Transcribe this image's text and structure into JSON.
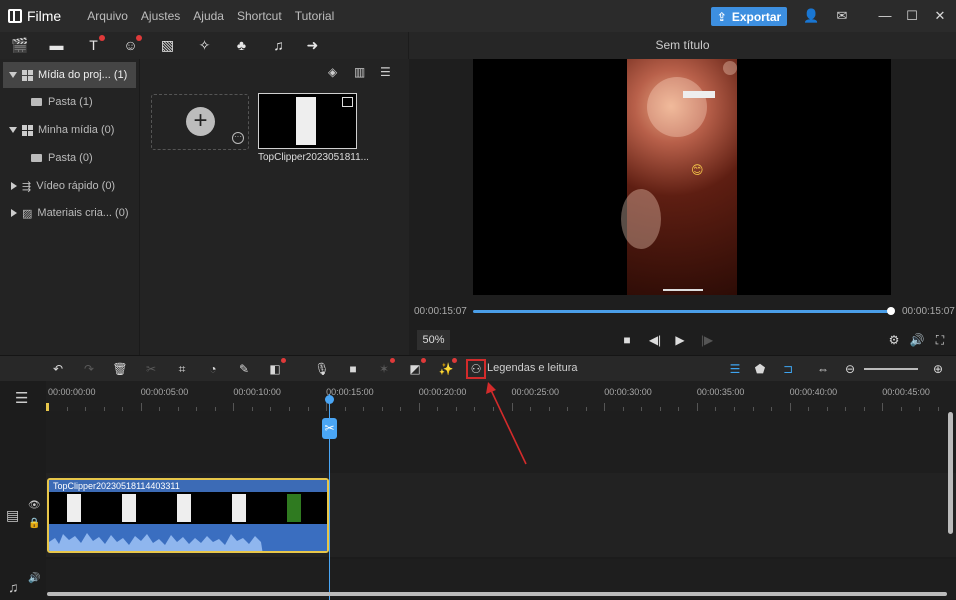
{
  "titlebar": {
    "app_name": "Filme",
    "menu": [
      "Arquivo",
      "Ajustes",
      "Ajuda",
      "Shortcut",
      "Tutorial"
    ],
    "export_label": "Exportar"
  },
  "sidebar": {
    "items": [
      {
        "label": "Mídia do proj... (1)"
      },
      {
        "label": "Pasta (1)"
      },
      {
        "label": "Minha mídia (0)"
      },
      {
        "label": "Pasta (0)"
      },
      {
        "label": "Vídeo rápido (0)"
      },
      {
        "label": "Materiais cria... (0)"
      }
    ]
  },
  "media": {
    "clip_name": "TopClipper2023051811..."
  },
  "preview": {
    "title": "Sem título",
    "time_current": "00:00:15:07",
    "time_total": "00:00:15:07",
    "zoom": "50%",
    "progress": 1.0
  },
  "toolbar": {
    "captions_label": "Legendas e leitura"
  },
  "timeline": {
    "ruler": [
      "00:00:00:00",
      "00:00:05:00",
      "00:00:10:00",
      "00:00:15:00",
      "00:00:20:00",
      "00:00:25:00",
      "00:00:30:00",
      "00:00:35:00",
      "00:00:40:00",
      "00:00:45:00"
    ],
    "clip_name": "TopClipper20230518114403311"
  },
  "colors": {
    "accent": "#3d8fe0",
    "clip_border": "#e7c64a",
    "highlight": "#d32b2b"
  }
}
